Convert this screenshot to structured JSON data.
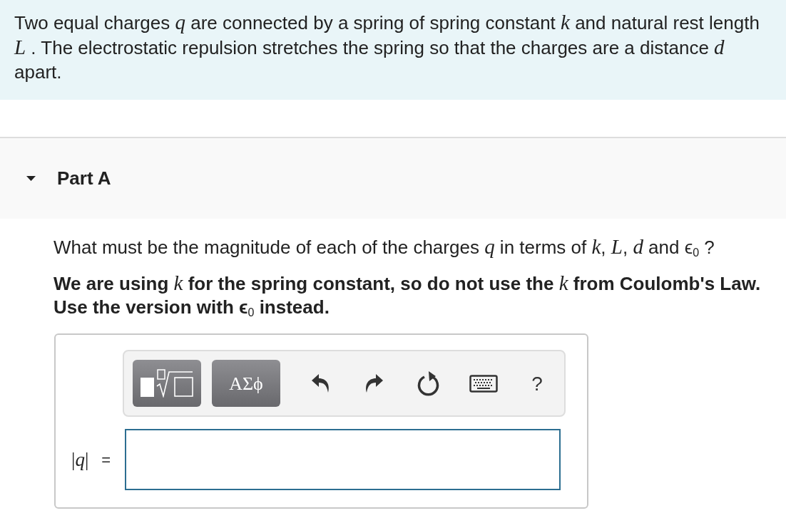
{
  "problem": {
    "text": "Two equal charges *q* are connected by a spring of spring constant *k* and natural rest length *L* .  The electrostatic repulsion stretches the spring so that the charges are a distance *d* apart."
  },
  "part": {
    "title": "Part A",
    "expanded": true,
    "question": "What must be the magnitude of each of the charges *q* in terms of *k*, *L*, *d*  and ϵ$_{0}$ ?",
    "note": "We are using *k* for the spring constant, so do not use the *k* from Coulomb's Law. Use the version with ϵ$_{0}$ instead.",
    "toolbar": {
      "symbols_button": "ΑΣϕ",
      "help_button": "?"
    },
    "answer": {
      "label": "|*q*|",
      "sign": "="
    }
  }
}
